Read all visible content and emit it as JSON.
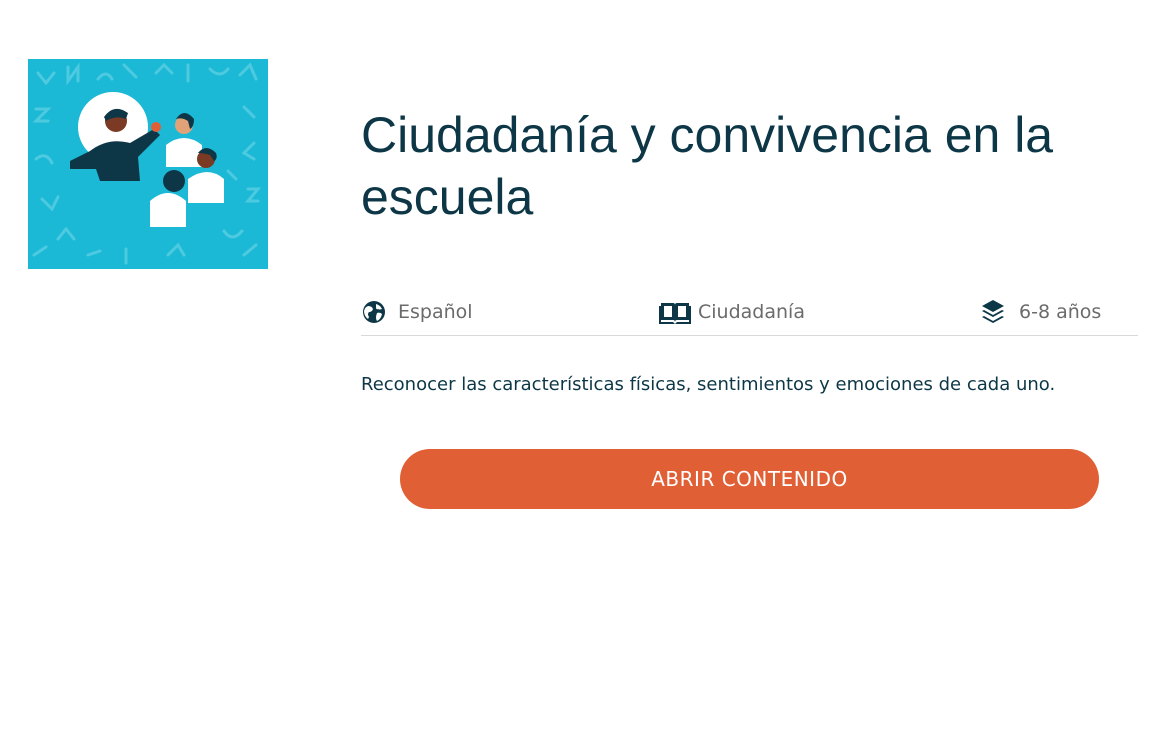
{
  "course": {
    "title": "Ciudadanía y convivencia en la escuela",
    "image_icon": "illustration-teacher-students",
    "meta": {
      "language": {
        "icon": "globe-icon",
        "label": "Español"
      },
      "subject": {
        "icon": "open-book-icon",
        "label": "Ciudadanía"
      },
      "age": {
        "icon": "layers-icon",
        "label": "6-8 años"
      }
    },
    "description": "Reconocer las características físicas, sentimientos y emociones de cada uno.",
    "open_button_label": "ABRIR CONTENIDO"
  },
  "colors": {
    "title": "#0d3746",
    "meta_text": "#6b6b6b",
    "button": "#e15f35",
    "thumbnail_bg": "#1bb9d6",
    "divider": "#d9d9d9"
  }
}
